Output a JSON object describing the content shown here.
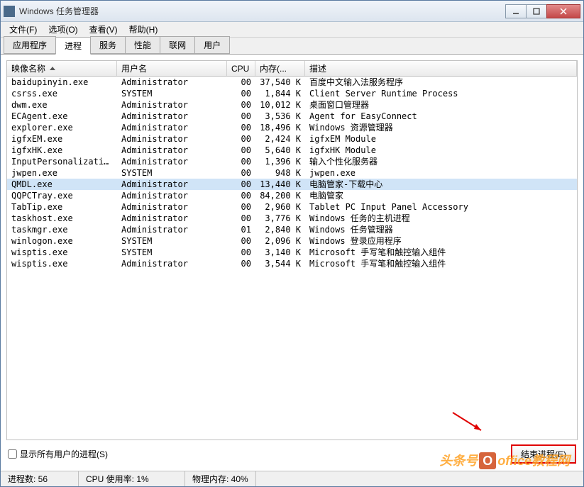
{
  "window": {
    "title": "Windows 任务管理器"
  },
  "menu": {
    "file": "文件(F)",
    "options": "选项(O)",
    "view": "查看(V)",
    "help": "帮助(H)"
  },
  "tabs": {
    "apps": "应用程序",
    "processes": "进程",
    "services": "服务",
    "performance": "性能",
    "network": "联网",
    "users": "用户"
  },
  "columns": {
    "name": "映像名称",
    "user": "用户名",
    "cpu": "CPU",
    "mem": "内存(...",
    "desc": "描述"
  },
  "processes": [
    {
      "name": "baidupinyin.exe",
      "user": "Administrator",
      "cpu": "00",
      "mem": "37,540 K",
      "desc": "百度中文输入法服务程序"
    },
    {
      "name": "csrss.exe",
      "user": "SYSTEM",
      "cpu": "00",
      "mem": "1,844 K",
      "desc": "Client Server Runtime Process"
    },
    {
      "name": "dwm.exe",
      "user": "Administrator",
      "cpu": "00",
      "mem": "10,012 K",
      "desc": "桌面窗口管理器"
    },
    {
      "name": "ECAgent.exe",
      "user": "Administrator",
      "cpu": "00",
      "mem": "3,536 K",
      "desc": "Agent for EasyConnect"
    },
    {
      "name": "explorer.exe",
      "user": "Administrator",
      "cpu": "00",
      "mem": "18,496 K",
      "desc": "Windows 资源管理器"
    },
    {
      "name": "igfxEM.exe",
      "user": "Administrator",
      "cpu": "00",
      "mem": "2,424 K",
      "desc": "igfxEM Module"
    },
    {
      "name": "igfxHK.exe",
      "user": "Administrator",
      "cpu": "00",
      "mem": "5,640 K",
      "desc": "igfxHK Module"
    },
    {
      "name": "InputPersonalization...",
      "user": "Administrator",
      "cpu": "00",
      "mem": "1,396 K",
      "desc": "输入个性化服务器"
    },
    {
      "name": "jwpen.exe",
      "user": "SYSTEM",
      "cpu": "00",
      "mem": "948 K",
      "desc": "jwpen.exe"
    },
    {
      "name": "QMDL.exe",
      "user": "Administrator",
      "cpu": "00",
      "mem": "13,440 K",
      "desc": "电脑管家-下载中心",
      "selected": true
    },
    {
      "name": "QQPCTray.exe",
      "user": "Administrator",
      "cpu": "00",
      "mem": "84,200 K",
      "desc": "电脑管家"
    },
    {
      "name": "TabTip.exe",
      "user": "Administrator",
      "cpu": "00",
      "mem": "2,960 K",
      "desc": "Tablet PC Input Panel Accessory"
    },
    {
      "name": "taskhost.exe",
      "user": "Administrator",
      "cpu": "00",
      "mem": "3,776 K",
      "desc": "Windows 任务的主机进程"
    },
    {
      "name": "taskmgr.exe",
      "user": "Administrator",
      "cpu": "01",
      "mem": "2,840 K",
      "desc": "Windows 任务管理器"
    },
    {
      "name": "winlogon.exe",
      "user": "SYSTEM",
      "cpu": "00",
      "mem": "2,096 K",
      "desc": "Windows 登录应用程序"
    },
    {
      "name": "wisptis.exe",
      "user": "SYSTEM",
      "cpu": "00",
      "mem": "3,140 K",
      "desc": "Microsoft 手写笔和触控输入组件"
    },
    {
      "name": "wisptis.exe",
      "user": "Administrator",
      "cpu": "00",
      "mem": "3,544 K",
      "desc": "Microsoft 手写笔和触控输入组件"
    }
  ],
  "bottom": {
    "show_all": "显示所有用户的进程(S)",
    "end_process": "结束进程(E)"
  },
  "status": {
    "count_label": "进程数: 56",
    "cpu_label": "CPU 使用率: 1%",
    "mem_label": "物理内存: 40%"
  },
  "watermark": "头条号 office教程网"
}
